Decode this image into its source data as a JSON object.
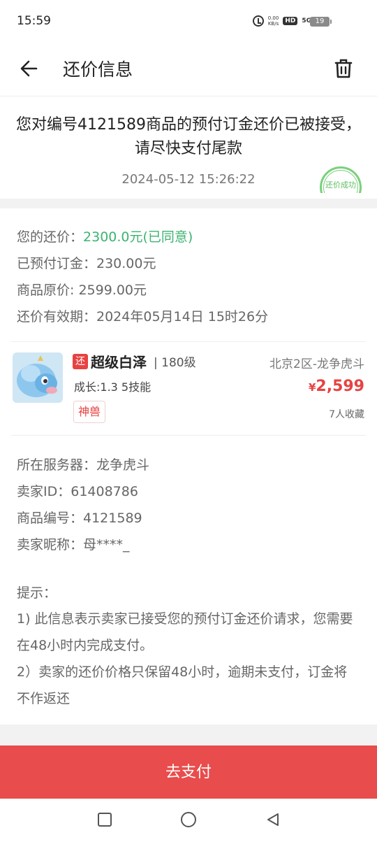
{
  "status_bar": {
    "time": "15:59",
    "net_speed_value": "0.00",
    "net_speed_unit": "KB/s",
    "hd": "HD",
    "network": "5G",
    "battery": "19"
  },
  "header": {
    "title": "还价信息",
    "back_icon": "arrow-left-icon",
    "delete_icon": "trash-icon"
  },
  "notice": {
    "message": "您对编号4121589商品的预付订金还价已被接受，请尽快支付尾款",
    "datetime": "2024-05-12 15:26:22",
    "stamp": "还价成功"
  },
  "offer": {
    "your_offer_label": "您的还价：",
    "your_offer_value": "2300.0元(已同意)",
    "deposit": "已预付订金：230.00元",
    "original_price": "商品原价: 2599.00元",
    "valid_until": "还价有效期：2024年05月14日 15时26分"
  },
  "product": {
    "tag": "还",
    "name": "超级白泽",
    "level": "| 180级",
    "server": "北京2区-龙争虎斗",
    "growth": "成长:1.3 5技能",
    "price_symbol": "¥",
    "price": "2,599",
    "badge": "神兽",
    "favorites": "7人收藏"
  },
  "details": {
    "server": "所在服务器：龙争虎斗",
    "seller_id": "卖家ID：61408786",
    "item_no": "商品编号：4121589",
    "seller_nick": "卖家昵称：母****_"
  },
  "tips": {
    "title": "提示：",
    "tip1": "1) 此信息表示卖家已接受您的预付订金还价请求，您需要在48小时内完成支付。",
    "tip2": "2）卖家的还价价格只保留48小时，逾期未支付，订金将不作返还"
  },
  "pay_button": "去支付",
  "colors": {
    "accent_red": "#e84c4c",
    "green": "#3cb371"
  }
}
